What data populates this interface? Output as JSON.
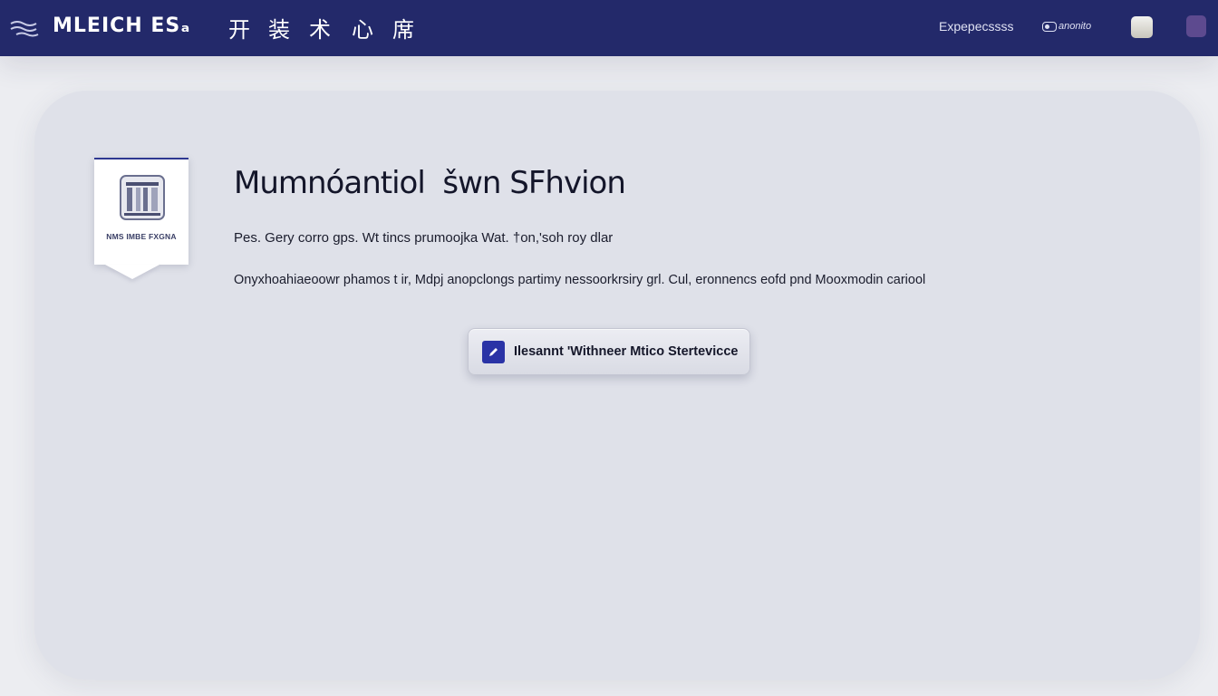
{
  "app": {
    "brand": "MLEICH ESₐ",
    "nav_glyphs": [
      "开",
      "装",
      "术",
      "心",
      "席"
    ],
    "nav_link": "Expepесssss",
    "account_label": "anonito"
  },
  "badge": {
    "label": "NMS IMBE FXGNA"
  },
  "content": {
    "title": "Mumnóantiol  šwn SFhvion",
    "subtitle": "Pes. Gery corro gps. Wt tincs prumoojka Wat. †on,'soh roy dlar",
    "description": "Onyxhoahiaeoowr phamos t ir, Mdpj anopclongs partimy nessoorkrsiry grl. Cul, eronnencs eofd pnd Mooxmodin cariool"
  },
  "action": {
    "label": "Ilesannt 'Withneer Mtico Stertevicce"
  },
  "icons": {
    "menu": "menu-icon",
    "emblem": "building-emblem-icon",
    "edit": "edit-icon",
    "account": "toggle-icon"
  },
  "colors": {
    "topbar": "#23296a",
    "card": "#dfe1e9",
    "accent": "#2a33a6",
    "violet": "#5d4a8f"
  }
}
